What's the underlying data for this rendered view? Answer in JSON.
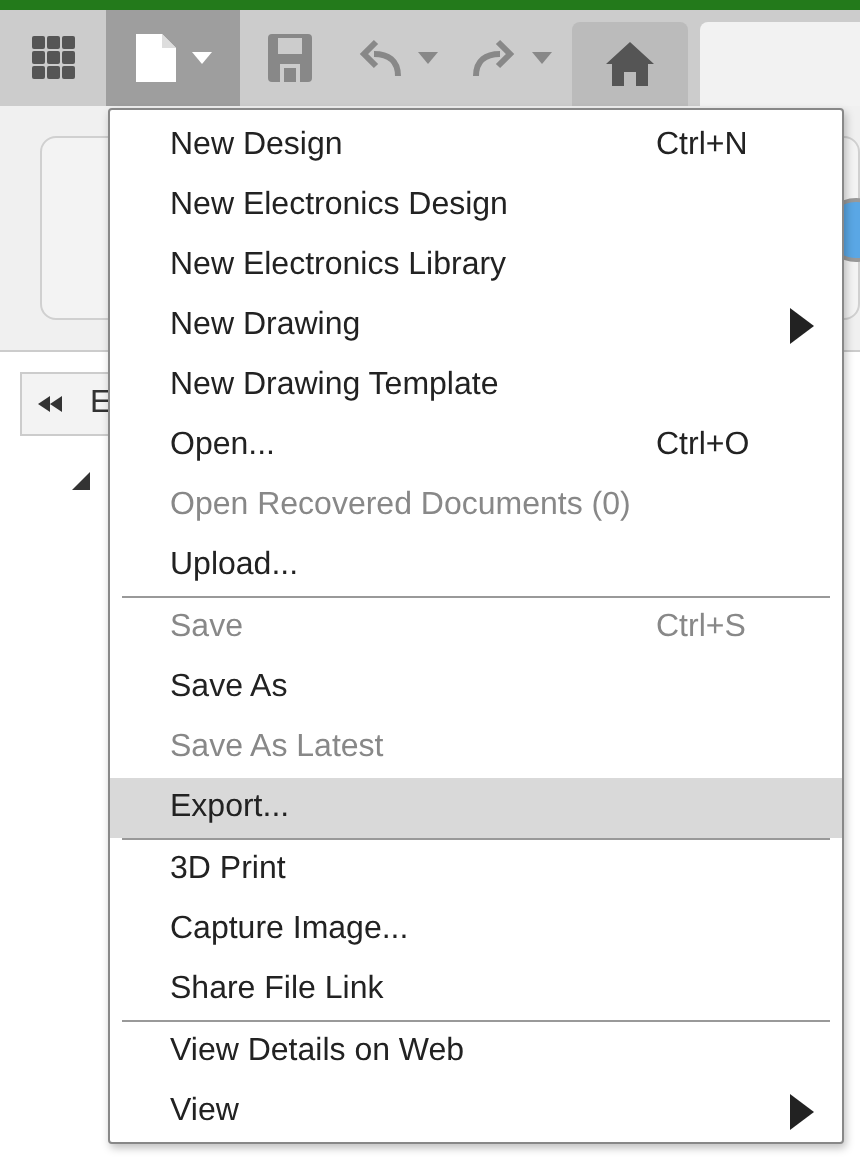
{
  "toolbar": [
    {
      "kind": "apps",
      "active": false,
      "dropdown": false,
      "disabled": false
    },
    {
      "kind": "file",
      "active": true,
      "dropdown": true,
      "disabled": false
    },
    {
      "kind": "save",
      "active": false,
      "dropdown": false,
      "disabled": true
    },
    {
      "kind": "undo",
      "active": false,
      "dropdown": true,
      "disabled": true
    },
    {
      "kind": "redo",
      "active": false,
      "dropdown": true,
      "disabled": true
    },
    {
      "kind": "home",
      "active": false,
      "dropdown": false,
      "disabled": false
    }
  ],
  "browser": {
    "back_button": "E"
  },
  "menu": {
    "sections": [
      [
        {
          "label": "New Design",
          "shortcut": "Ctrl+N",
          "disabled": false,
          "submenu": false,
          "selected": false
        },
        {
          "label": "New Electronics Design",
          "disabled": false,
          "submenu": false,
          "selected": false
        },
        {
          "label": "New Electronics Library",
          "disabled": false,
          "submenu": false,
          "selected": false
        },
        {
          "label": "New Drawing",
          "disabled": false,
          "submenu": true,
          "selected": false
        },
        {
          "label": "New Drawing Template",
          "disabled": false,
          "submenu": false,
          "selected": false
        },
        {
          "label": "Open...",
          "shortcut": "Ctrl+O",
          "disabled": false,
          "submenu": false,
          "selected": false
        },
        {
          "label": "Open Recovered Documents (0)",
          "disabled": true,
          "submenu": false,
          "selected": false
        },
        {
          "label": "Upload...",
          "disabled": false,
          "submenu": false,
          "selected": false
        }
      ],
      [
        {
          "label": "Save",
          "shortcut": "Ctrl+S",
          "disabled": true,
          "submenu": false,
          "selected": false
        },
        {
          "label": "Save As",
          "disabled": false,
          "submenu": false,
          "selected": false
        },
        {
          "label": "Save As Latest",
          "disabled": true,
          "submenu": false,
          "selected": false
        },
        {
          "label": "Export...",
          "disabled": false,
          "submenu": false,
          "selected": true
        }
      ],
      [
        {
          "label": "3D Print",
          "disabled": false,
          "submenu": false,
          "selected": false
        },
        {
          "label": "Capture Image...",
          "disabled": false,
          "submenu": false,
          "selected": false
        },
        {
          "label": "Share File Link",
          "disabled": false,
          "submenu": false,
          "selected": false
        }
      ],
      [
        {
          "label": "View Details on Web",
          "disabled": false,
          "submenu": false,
          "selected": false
        },
        {
          "label": "View",
          "disabled": false,
          "submenu": true,
          "selected": false
        }
      ]
    ]
  }
}
